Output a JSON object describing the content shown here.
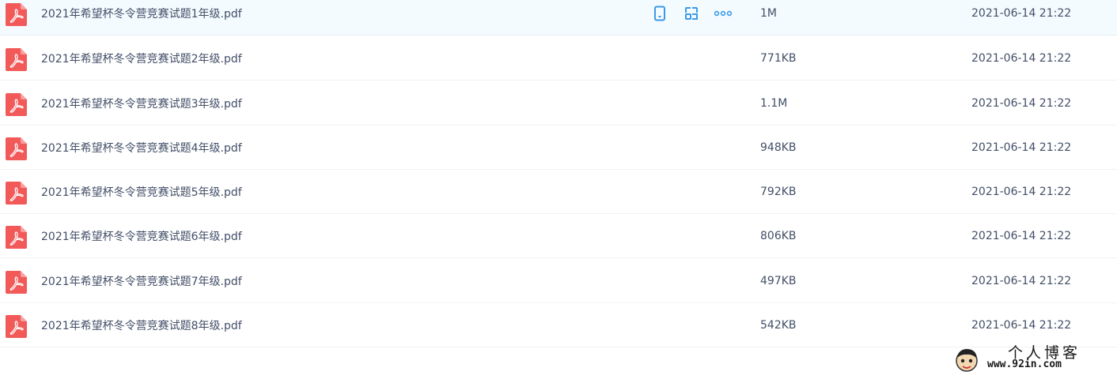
{
  "files": [
    {
      "name": "2021年希望杯冬令营竞赛试题1年级.pdf",
      "size": "1M",
      "date": "2021-06-14 21:22",
      "hovered": true
    },
    {
      "name": "2021年希望杯冬令营竞赛试题2年级.pdf",
      "size": "771KB",
      "date": "2021-06-14 21:22"
    },
    {
      "name": "2021年希望杯冬令营竞赛试题3年级.pdf",
      "size": "1.1M",
      "date": "2021-06-14 21:22"
    },
    {
      "name": "2021年希望杯冬令营竞赛试题4年级.pdf",
      "size": "948KB",
      "date": "2021-06-14 21:22"
    },
    {
      "name": "2021年希望杯冬令营竞赛试题5年级.pdf",
      "size": "792KB",
      "date": "2021-06-14 21:22"
    },
    {
      "name": "2021年希望杯冬令营竞赛试题6年级.pdf",
      "size": "806KB",
      "date": "2021-06-14 21:22"
    },
    {
      "name": "2021年希望杯冬令营竞赛试题7年级.pdf",
      "size": "497KB",
      "date": "2021-06-14 21:22"
    },
    {
      "name": "2021年希望杯冬令营竞赛试题8年级.pdf",
      "size": "542KB",
      "date": "2021-06-14 21:22"
    }
  ],
  "file_icon": "pdf-file-icon",
  "row_actions": [
    "phone-icon",
    "share-icon",
    "more-icon"
  ],
  "watermark": {
    "title": "个人博客",
    "url": "www.92in.com"
  },
  "colors": {
    "pdf": "#f25a5a",
    "action": "#3b9ae8",
    "hover_bg": "#f4fbff"
  }
}
